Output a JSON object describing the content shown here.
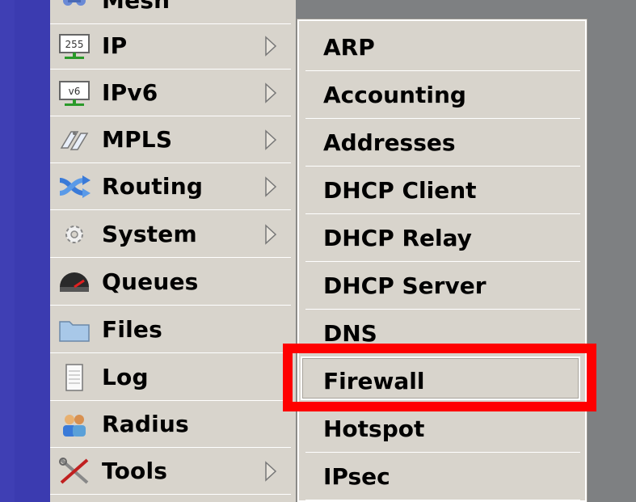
{
  "left_menu": {
    "items": [
      {
        "label": "Mesh",
        "icon": "mesh-icon",
        "has_submenu": false
      },
      {
        "label": "IP",
        "icon": "ip-icon",
        "has_submenu": true
      },
      {
        "label": "IPv6",
        "icon": "ipv6-icon",
        "has_submenu": true
      },
      {
        "label": "MPLS",
        "icon": "mpls-icon",
        "has_submenu": true
      },
      {
        "label": "Routing",
        "icon": "routing-icon",
        "has_submenu": true
      },
      {
        "label": "System",
        "icon": "gear-icon",
        "has_submenu": true
      },
      {
        "label": "Queues",
        "icon": "queues-icon",
        "has_submenu": false
      },
      {
        "label": "Files",
        "icon": "folder-icon",
        "has_submenu": false
      },
      {
        "label": "Log",
        "icon": "log-icon",
        "has_submenu": false
      },
      {
        "label": "Radius",
        "icon": "radius-icon",
        "has_submenu": false
      },
      {
        "label": "Tools",
        "icon": "tools-icon",
        "has_submenu": true
      }
    ]
  },
  "icon_text": {
    "ip": "255",
    "ipv6": "v6"
  },
  "submenu": {
    "items": [
      {
        "label": "ARP"
      },
      {
        "label": "Accounting"
      },
      {
        "label": "Addresses"
      },
      {
        "label": "DHCP Client"
      },
      {
        "label": "DHCP Relay"
      },
      {
        "label": "DHCP Server"
      },
      {
        "label": "DNS"
      },
      {
        "label": "Firewall",
        "highlighted": true
      },
      {
        "label": "Hotspot"
      },
      {
        "label": "IPsec"
      }
    ]
  },
  "colors": {
    "menu_bg": "#d8d4cc",
    "sidebar_blue": "#3b3bb0",
    "highlight_red": "#ff0000",
    "window_gray": "#7e8082"
  }
}
